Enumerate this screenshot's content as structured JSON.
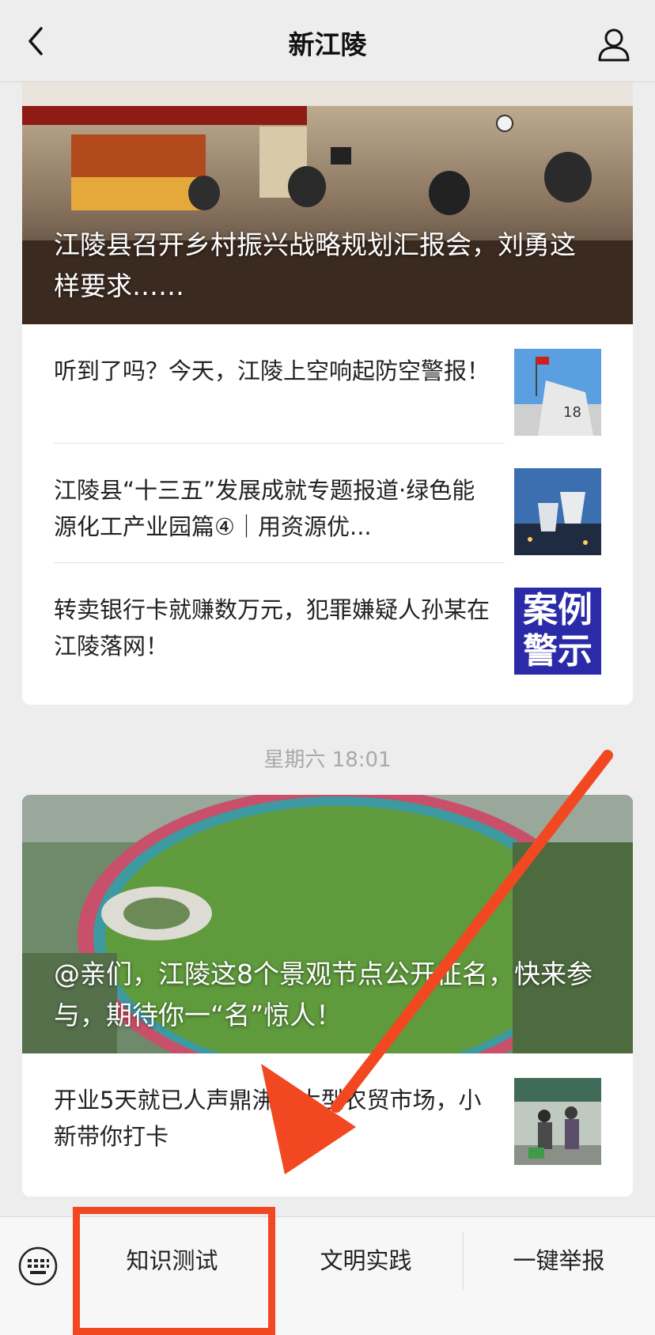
{
  "navbar": {
    "title": "新江陵",
    "back_icon": "chevron-left-icon",
    "profile_icon": "person-icon"
  },
  "feed": [
    {
      "hero": {
        "title": "江陵县召开乡村振兴战略规划汇报会，刘勇这样要求……"
      },
      "items": [
        {
          "title": "听到了吗？今天，江陵上空响起防空警报！"
        },
        {
          "title": "江陵县“十三五”发展成就专题报道·绿色能源化工产业园篇④｜用资源优..."
        },
        {
          "title": "转卖银行卡就赚数万元，犯罪嫌疑人孙某在江陵落网！",
          "thumb_text": [
            "案例",
            "警示"
          ]
        }
      ]
    },
    {
      "timestamp": "星期六 18:01",
      "hero": {
        "title": "@亲们，江陵这8个景观节点公开征名，快来参与，期待你一“名”惊人！"
      },
      "items": [
        {
          "title": "开业5天就已人声鼎沸的大型农贸市场，小新带你打卡"
        }
      ]
    }
  ],
  "bottom_menu": {
    "keyboard_icon": "keyboard-icon",
    "items": [
      "知识测试",
      "文明实践",
      "一键举报"
    ]
  },
  "annotation": {
    "color": "#f24822"
  }
}
